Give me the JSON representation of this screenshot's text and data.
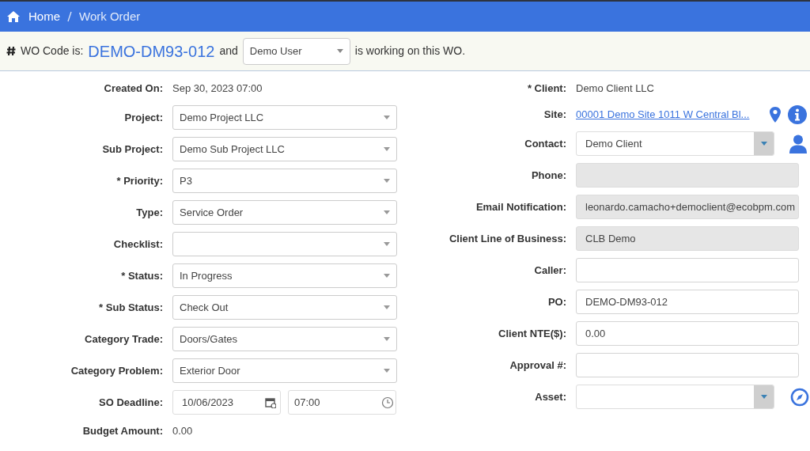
{
  "breadcrumb": [
    "Home",
    "Work Order"
  ],
  "wo_bar": {
    "prefix": "WO Code is:",
    "code": "DEMO-DM93-012",
    "joiner": "and",
    "user": "Demo User",
    "suffix": "is working on this WO."
  },
  "left_fields": [
    {
      "kind": "text",
      "label": "Created On:",
      "value": "Sep 30, 2023 07:00"
    },
    {
      "kind": "select",
      "label": "Project:",
      "value": "Demo Project LLC"
    },
    {
      "kind": "select",
      "label": "Sub Project:",
      "value": "Demo Sub Project LLC"
    },
    {
      "kind": "select",
      "label": "* Priority:",
      "value": "P3"
    },
    {
      "kind": "select",
      "label": "Type:",
      "value": "Service Order"
    },
    {
      "kind": "select",
      "label": "Checklist:"
    },
    {
      "kind": "select",
      "label": "* Status:",
      "value": "In Progress"
    },
    {
      "kind": "select",
      "label": "* Sub Status:",
      "value": "Check Out"
    },
    {
      "kind": "select",
      "label": "Category Trade:",
      "value": "Doors/Gates"
    },
    {
      "kind": "select",
      "label": "Category Problem:",
      "value": "Exterior Door"
    },
    {
      "kind": "datetime",
      "label": "SO Deadline:",
      "date": "10/06/2023",
      "time": "07:00"
    },
    {
      "kind": "text",
      "label": "Budget Amount:",
      "value": "0.00"
    }
  ],
  "right_fields": [
    {
      "kind": "text",
      "label": "* Client:",
      "value": "Demo Client LLC"
    },
    {
      "kind": "site_link",
      "label": "Site:",
      "value": "00001 Demo Site 1011 W Central Bl..."
    },
    {
      "kind": "contact_combo",
      "label": "Contact:",
      "value": "Demo Client"
    },
    {
      "kind": "input",
      "label": "Phone:",
      "disabled": true
    },
    {
      "kind": "input",
      "label": "Email Notification:",
      "value": "leonardo.camacho+democlient@ecobpm.com",
      "disabled": true
    },
    {
      "kind": "input",
      "label": "Client Line of Business:",
      "value": "CLB Demo",
      "disabled": true
    },
    {
      "kind": "input",
      "label": "Caller:",
      "disabled": false
    },
    {
      "kind": "input",
      "label": "PO:",
      "value": "DEMO-DM93-012",
      "disabled": false
    },
    {
      "kind": "input",
      "label": "Client NTE($):",
      "value": "0.00",
      "disabled": false
    },
    {
      "kind": "input",
      "label": "Approval #:",
      "disabled": false
    },
    {
      "kind": "asset_combo",
      "label": "Asset:"
    }
  ]
}
